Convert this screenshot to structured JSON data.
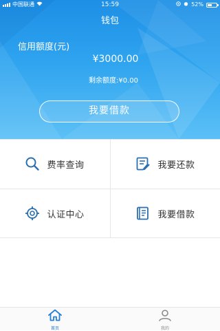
{
  "status_bar": {
    "carrier": "中国联通",
    "time": "15:59",
    "battery": "52%",
    "battery_level": 0.52
  },
  "header": {
    "title": "钱包",
    "credit_label": "信用额度(元)",
    "credit_amount": "¥3000.00",
    "remaining": "剩余额度:¥0.00",
    "borrow_button": "我要借款"
  },
  "menu": [
    {
      "label": "费率查询",
      "icon": "search-icon"
    },
    {
      "label": "我要还款",
      "icon": "repay-icon"
    },
    {
      "label": "认证中心",
      "icon": "target-icon"
    },
    {
      "label": "我要借款",
      "icon": "borrow-book-icon"
    }
  ],
  "tabs": [
    {
      "label": "首页",
      "icon": "home-icon",
      "active": true
    },
    {
      "label": "我的",
      "icon": "user-icon",
      "active": false
    }
  ],
  "colors": {
    "primary": "#1f8fe5",
    "icon": "#2a6fb0",
    "tab_active": "#2a7fd4",
    "tab_inactive": "#8a8a8a"
  }
}
